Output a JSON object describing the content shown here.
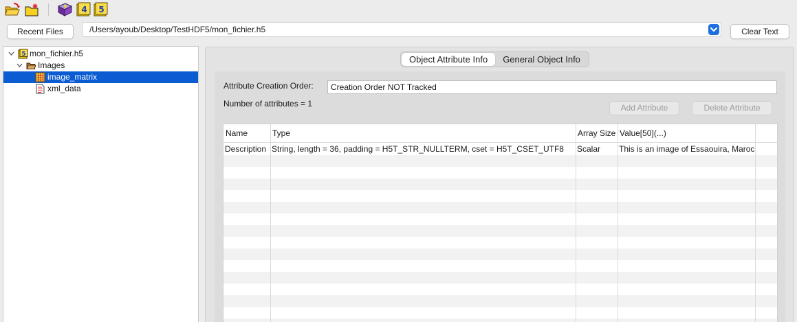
{
  "toolbar": {
    "icons": [
      "open-file-icon",
      "new-folder-icon",
      "help-book-icon",
      "hdf4-library-icon",
      "hdf5-library-icon"
    ]
  },
  "file_bar": {
    "recent_label": "Recent Files",
    "path_value": "/Users/ayoub/Desktop/TestHDF5/mon_fichier.h5",
    "clear_label": "Clear Text"
  },
  "tree": {
    "root": "mon_fichier.h5",
    "group": "Images",
    "items": [
      "image_matrix",
      "xml_data"
    ]
  },
  "tabs": {
    "attr_info": "Object Attribute Info",
    "general_info": "General Object Info"
  },
  "attr": {
    "creation_order_label": "Attribute Creation Order:",
    "creation_order_value": "Creation Order NOT Tracked",
    "count_label": "Number of attributes = 1",
    "add_label": "Add Attribute",
    "delete_label": "Delete Attribute"
  },
  "table": {
    "headers": [
      "Name",
      "Type",
      "Array Size",
      "Value[50](...)"
    ],
    "rows": [
      [
        "Description",
        "String, length = 36, padding = H5T_STR_NULLTERM, cset = H5T_CSET_UTF8",
        "Scalar",
        "This is an image of Essaouira, Maroc"
      ]
    ]
  },
  "colors": {
    "selection": "#0b5bd3",
    "dropdown_accent": "#1f6fe0"
  }
}
